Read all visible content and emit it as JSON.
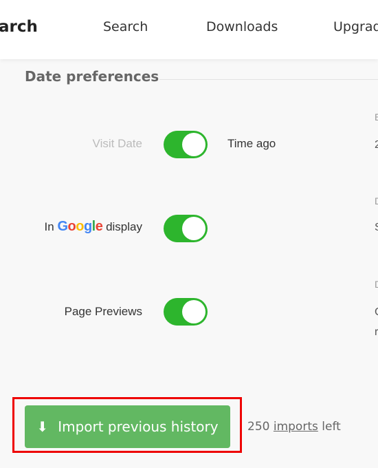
{
  "header": {
    "brand": "arch",
    "nav": [
      "Search",
      "Downloads",
      "Upgrade"
    ]
  },
  "section": {
    "title": "Date preferences"
  },
  "rows": [
    {
      "label": "Visit Date",
      "enabled": true,
      "value": "Time ago",
      "muted": true
    },
    {
      "label_prefix": "In",
      "label_logo": "Google",
      "label_suffix": "display",
      "enabled": true
    },
    {
      "label": "Page Previews",
      "enabled": true
    }
  ],
  "right_column_fragments": [
    "E",
    "2",
    "D",
    "S",
    "D",
    "C",
    "r"
  ],
  "colors": {
    "toggle_on": "#2db52d",
    "button": "#62b862",
    "highlight": "#e00000"
  },
  "import": {
    "icon": "arrow-down-icon",
    "label": "Import previous history",
    "count": "250",
    "link": "imports",
    "suffix": "left"
  }
}
